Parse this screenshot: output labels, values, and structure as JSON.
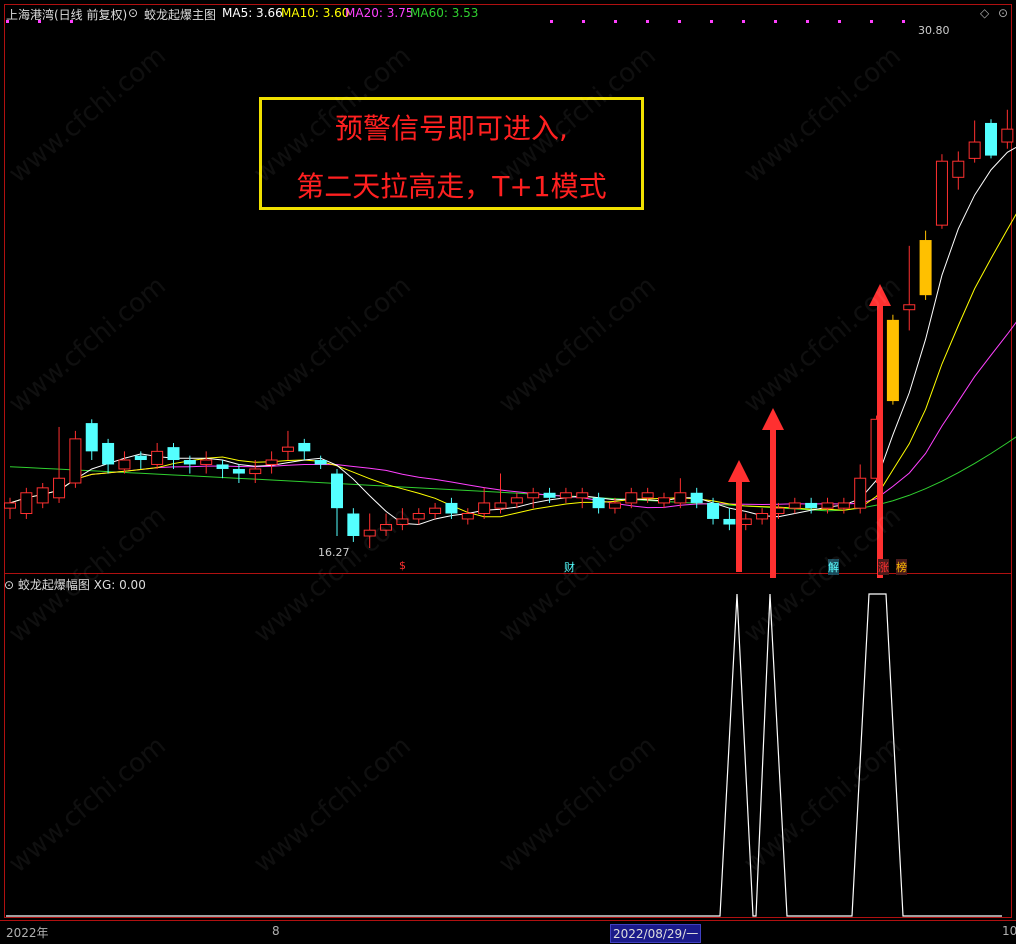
{
  "header": {
    "stock": "上海港湾(日线 前复权)",
    "indicator": "蛟龙起爆主图",
    "ma5": "MA5: 3.66",
    "ma10": "MA10: 3.60",
    "ma20": "MA20: 3.75",
    "ma60": "MA60: 3.53"
  },
  "annotation": {
    "line1": "预警信号即可进入,",
    "line2": "第二天拉高走，T+1模式"
  },
  "price_labels": {
    "high": "30.80",
    "low": "16.27"
  },
  "markers": {
    "s": "$",
    "cai": "财",
    "jie": "解",
    "zhang": "涨",
    "bang": "榜"
  },
  "sub_panel": {
    "title": "蛟龙起爆幅图",
    "xg": "XG: 0.00"
  },
  "xaxis": {
    "year": "2022年",
    "month": "8",
    "date": "2022/08/29/一",
    "right": "10"
  },
  "watermark": "www.cfchi.com",
  "colors": {
    "up": "#ff3030",
    "down": "#54ffff",
    "gold": "#ffc000",
    "ma5": "#ffffff",
    "ma10": "#ffff00",
    "ma20": "#ff40ff",
    "ma60": "#30d030",
    "arrow": "#ff3030"
  },
  "candles": [
    [
      5.0,
      5.1,
      4.8,
      5.2,
      "r"
    ],
    [
      4.9,
      5.3,
      4.8,
      5.4,
      "r"
    ],
    [
      5.1,
      5.4,
      5.0,
      5.5,
      "r"
    ],
    [
      5.2,
      5.6,
      5.1,
      6.8,
      "r"
    ],
    [
      5.5,
      6.5,
      5.4,
      6.7,
      "r"
    ],
    [
      6.9,
      6.2,
      6.0,
      7.0,
      "c"
    ],
    [
      6.4,
      5.9,
      5.7,
      6.5,
      "c"
    ],
    [
      5.8,
      6.0,
      5.7,
      6.2,
      "r"
    ],
    [
      6.0,
      6.1,
      5.8,
      6.2,
      "c"
    ],
    [
      5.9,
      6.2,
      5.8,
      6.4,
      "r"
    ],
    [
      6.3,
      6.0,
      5.8,
      6.4,
      "c"
    ],
    [
      6.0,
      5.9,
      5.7,
      6.1,
      "c"
    ],
    [
      5.9,
      6.0,
      5.7,
      6.2,
      "r"
    ],
    [
      5.8,
      5.9,
      5.6,
      6.0,
      "c"
    ],
    [
      5.8,
      5.7,
      5.5,
      5.9,
      "c"
    ],
    [
      5.7,
      5.8,
      5.5,
      6.0,
      "r"
    ],
    [
      5.9,
      6.0,
      5.7,
      6.2,
      "r"
    ],
    [
      6.2,
      6.3,
      6.0,
      6.7,
      "r"
    ],
    [
      6.4,
      6.2,
      6.0,
      6.5,
      "c"
    ],
    [
      6.0,
      5.9,
      5.8,
      6.1,
      "c"
    ],
    [
      5.7,
      5.0,
      4.5,
      5.8,
      "c"
    ],
    [
      4.9,
      4.5,
      4.4,
      5.0,
      "c"
    ],
    [
      4.5,
      4.6,
      4.3,
      4.9,
      "r"
    ],
    [
      4.6,
      4.7,
      4.5,
      4.9,
      "r"
    ],
    [
      4.7,
      4.8,
      4.6,
      5.0,
      "r"
    ],
    [
      4.8,
      4.9,
      4.7,
      5.0,
      "r"
    ],
    [
      4.9,
      5.0,
      4.8,
      5.1,
      "r"
    ],
    [
      5.1,
      4.9,
      4.8,
      5.2,
      "c"
    ],
    [
      4.8,
      4.9,
      4.7,
      5.0,
      "r"
    ],
    [
      4.9,
      5.1,
      4.8,
      5.4,
      "r"
    ],
    [
      5.1,
      5.0,
      4.9,
      5.7,
      "r"
    ],
    [
      5.1,
      5.2,
      5.0,
      5.3,
      "r"
    ],
    [
      5.2,
      5.3,
      5.0,
      5.4,
      "r"
    ],
    [
      5.3,
      5.2,
      5.1,
      5.4,
      "c"
    ],
    [
      5.2,
      5.3,
      5.1,
      5.4,
      "r"
    ],
    [
      5.3,
      5.2,
      5.0,
      5.4,
      "r"
    ],
    [
      5.2,
      5.0,
      4.9,
      5.3,
      "c"
    ],
    [
      5.0,
      5.1,
      4.9,
      5.2,
      "r"
    ],
    [
      5.1,
      5.3,
      5.0,
      5.4,
      "r"
    ],
    [
      5.3,
      5.2,
      5.1,
      5.4,
      "r"
    ],
    [
      5.2,
      5.1,
      5.0,
      5.3,
      "r"
    ],
    [
      5.1,
      5.3,
      5.0,
      5.6,
      "r"
    ],
    [
      5.3,
      5.1,
      5.0,
      5.4,
      "c"
    ],
    [
      5.1,
      4.8,
      4.7,
      5.2,
      "c"
    ],
    [
      4.8,
      4.7,
      4.6,
      5.0,
      "c"
    ],
    [
      4.7,
      4.8,
      4.6,
      4.9,
      "r"
    ],
    [
      4.8,
      4.9,
      4.7,
      5.0,
      "r"
    ],
    [
      4.9,
      5.0,
      4.8,
      5.1,
      "r"
    ],
    [
      5.0,
      5.1,
      4.9,
      5.2,
      "r"
    ],
    [
      5.1,
      5.0,
      4.9,
      5.2,
      "c"
    ],
    [
      5.0,
      5.1,
      4.9,
      5.2,
      "r"
    ],
    [
      5.0,
      5.1,
      4.9,
      5.2,
      "r"
    ],
    [
      5.0,
      5.6,
      4.9,
      5.9,
      "r"
    ],
    [
      5.6,
      7.0,
      5.5,
      7.1,
      "r"
    ],
    [
      7.5,
      10.2,
      7.4,
      10.4,
      "g"
    ],
    [
      10.6,
      10.8,
      9.8,
      13.5,
      "r"
    ],
    [
      11.2,
      13.8,
      11.0,
      14.3,
      "g"
    ],
    [
      14.6,
      18.6,
      14.4,
      19.1,
      "r"
    ],
    [
      17.5,
      18.6,
      16.7,
      19.3,
      "r"
    ],
    [
      18.8,
      20.0,
      18.5,
      21.7,
      "r"
    ],
    [
      21.5,
      19.0,
      18.8,
      21.8,
      "c"
    ],
    [
      21.0,
      20.0,
      19.5,
      22.6,
      "r"
    ],
    [
      20.8,
      22.0,
      17.5,
      22.8,
      "c"
    ],
    [
      19.5,
      23.5,
      19.5,
      24.3,
      "g"
    ],
    [
      24.3,
      28.5,
      24.0,
      28.8,
      "g"
    ],
    [
      30.5,
      26.0,
      25.8,
      30.8,
      "c"
    ],
    [
      25.8,
      25.4,
      23.7,
      27.3,
      "c"
    ],
    [
      25.1,
      24.0,
      23.3,
      26.1,
      "c"
    ],
    [
      25.2,
      23.5,
      22.0,
      26.1,
      "c"
    ],
    [
      22.7,
      22.4,
      21.6,
      23.3,
      "r"
    ],
    [
      22.3,
      18.7,
      18.2,
      22.7,
      "c"
    ],
    [
      19.5,
      18.3,
      17.8,
      19.6,
      "c"
    ]
  ]
}
